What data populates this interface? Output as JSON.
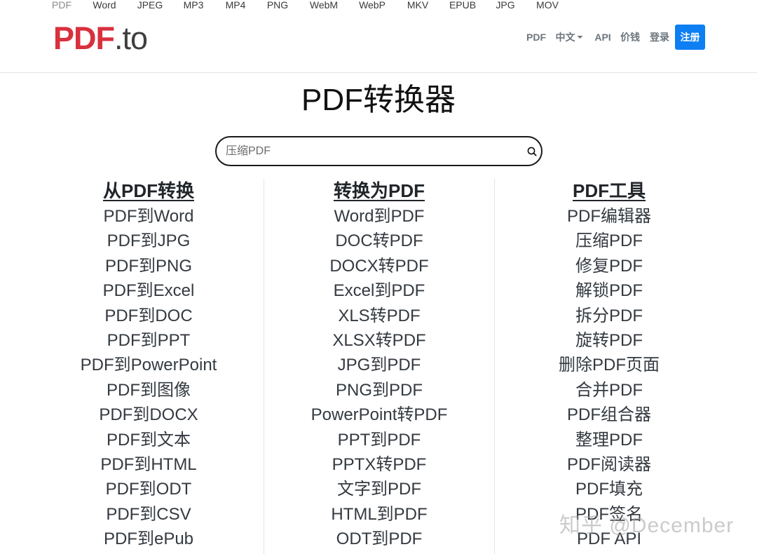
{
  "format_bar": [
    "PDF",
    "Word",
    "JPEG",
    "MP3",
    "MP4",
    "PNG",
    "WebM",
    "WebP",
    "MKV",
    "EPUB",
    "JPG",
    "MOV"
  ],
  "logo": {
    "brand": "PDF",
    "suffix": ".to",
    "brand_color": "#d9303d"
  },
  "nav": {
    "pdf": "PDF",
    "language": "中文",
    "api": "API",
    "pricing": "价钱",
    "login": "登录",
    "signup": "注册",
    "accent_color": "#0d7ff2"
  },
  "page_title": "PDF转换器",
  "search": {
    "placeholder": "压缩PDF",
    "icon": "search-icon"
  },
  "columns": [
    {
      "heading": "从PDF转换",
      "items": [
        "PDF到Word",
        "PDF到JPG",
        "PDF到PNG",
        "PDF到Excel",
        "PDF到DOC",
        "PDF到PPT",
        "PDF到PowerPoint",
        "PDF到图像",
        "PDF到DOCX",
        "PDF到文本",
        "PDF到HTML",
        "PDF到ODT",
        "PDF到CSV",
        "PDF到ePub"
      ]
    },
    {
      "heading": "转换为PDF",
      "items": [
        "Word到PDF",
        "DOC转PDF",
        "DOCX转PDF",
        "Excel到PDF",
        "XLS转PDF",
        "XLSX转PDF",
        "JPG到PDF",
        "PNG到PDF",
        "PowerPoint转PDF",
        "PPT到PDF",
        "PPTX转PDF",
        "文字到PDF",
        "HTML到PDF",
        "ODT到PDF"
      ]
    },
    {
      "heading": "PDF工具",
      "items": [
        "PDF编辑器",
        "压缩PDF",
        "修复PDF",
        "解锁PDF",
        "拆分PDF",
        "旋转PDF",
        "删除PDF页面",
        "合并PDF",
        "PDF组合器",
        "整理PDF",
        "PDF阅读器",
        "PDF填充",
        "PDF签名",
        "PDF API"
      ]
    }
  ],
  "watermark": "知乎 @December"
}
